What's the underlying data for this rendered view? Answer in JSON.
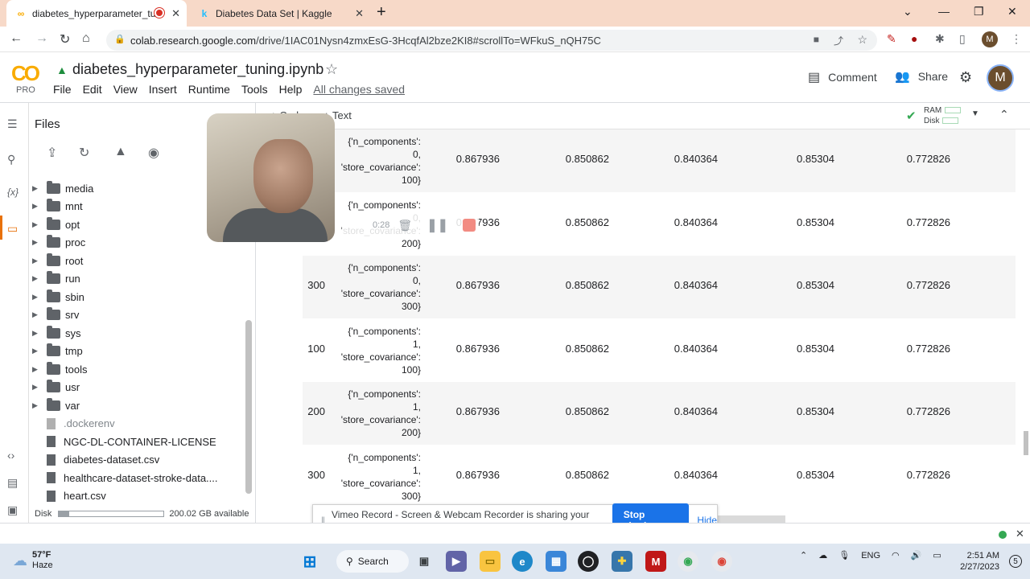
{
  "browser": {
    "tabs": [
      {
        "title": "diabetes_hyperparameter_tu",
        "favicon": "CO"
      },
      {
        "title": "Diabetes Data Set | Kaggle",
        "favicon": "k"
      }
    ],
    "new_tab": "+",
    "url_host": "colab.research.google.com",
    "url_path": "/drive/1IAC01Nysn4zmxEsG-3HcqfAl2bze2KI8#scrollTo=WFkuS_nQH75C",
    "profile_initial": "M"
  },
  "colab": {
    "logo": "CO",
    "plan": "PRO",
    "notebook_title": "diabetes_hyperparameter_tuning.ipynb",
    "menu": [
      "File",
      "Edit",
      "View",
      "Insert",
      "Runtime",
      "Tools",
      "Help"
    ],
    "save_status": "All changes saved",
    "comment_label": "Comment",
    "share_label": "Share",
    "avatar_initial": "M"
  },
  "files": {
    "title": "Files",
    "folders": [
      "media",
      "mnt",
      "opt",
      "proc",
      "root",
      "run",
      "sbin",
      "srv",
      "sys",
      "tmp",
      "tools",
      "usr",
      "var"
    ],
    "files": [
      ".dockerenv",
      "NGC-DL-CONTAINER-LICENSE",
      "diabetes-dataset.csv",
      "healthcare-dataset-stroke-data....",
      "heart.csv"
    ],
    "disk_label": "Disk",
    "disk_available": "200.02 GB available",
    "disk_used_fraction": 0.1
  },
  "notebook": {
    "add_code": "+ Code",
    "add_text": "+ Text",
    "ram_label": "RAM",
    "disk_label": "Disk",
    "rows": [
      {
        "index": "",
        "params": [
          "{'n_components':",
          "0,",
          "'store_covariance':",
          "100}"
        ],
        "values": [
          "0.867936",
          "0.850862",
          "0.840364",
          "0.85304",
          "0.772826"
        ],
        "shaded": true
      },
      {
        "index": "",
        "params": [
          "{'n_components':",
          "0,",
          "'store_covariance':",
          "200}"
        ],
        "values": [
          "0.867936",
          "0.850862",
          "0.840364",
          "0.85304",
          "0.772826"
        ],
        "shaded": false
      },
      {
        "index": "300",
        "params": [
          "{'n_components':",
          "0,",
          "'store_covariance':",
          "300}"
        ],
        "values": [
          "0.867936",
          "0.850862",
          "0.840364",
          "0.85304",
          "0.772826"
        ],
        "shaded": true
      },
      {
        "index": "100",
        "params": [
          "{'n_components':",
          "1,",
          "'store_covariance':",
          "100}"
        ],
        "values": [
          "0.867936",
          "0.850862",
          "0.840364",
          "0.85304",
          "0.772826"
        ],
        "shaded": false
      },
      {
        "index": "200",
        "params": [
          "{'n_components':",
          "1,",
          "'store_covariance':",
          "200}"
        ],
        "values": [
          "0.867936",
          "0.850862",
          "0.840364",
          "0.85304",
          "0.772826"
        ],
        "shaded": true
      },
      {
        "index": "300",
        "params": [
          "{'n_components':",
          "1,",
          "'store_covariance':",
          "300}"
        ],
        "values": [
          "0.867936",
          "0.850862",
          "0.840364",
          "0.85304",
          "0.772826"
        ],
        "shaded": false
      }
    ]
  },
  "recorder": {
    "timer": "0:28",
    "banner_text": "Vimeo Record - Screen & Webcam Recorder is sharing your screen.",
    "stop_label": "Stop sharing",
    "hide_label": "Hide"
  },
  "taskbar": {
    "temperature": "57°F",
    "weather": "Haze",
    "search_label": "Search",
    "language": "ENG",
    "time": "2:51 AM",
    "date": "2/27/2023",
    "notifications": "5"
  }
}
